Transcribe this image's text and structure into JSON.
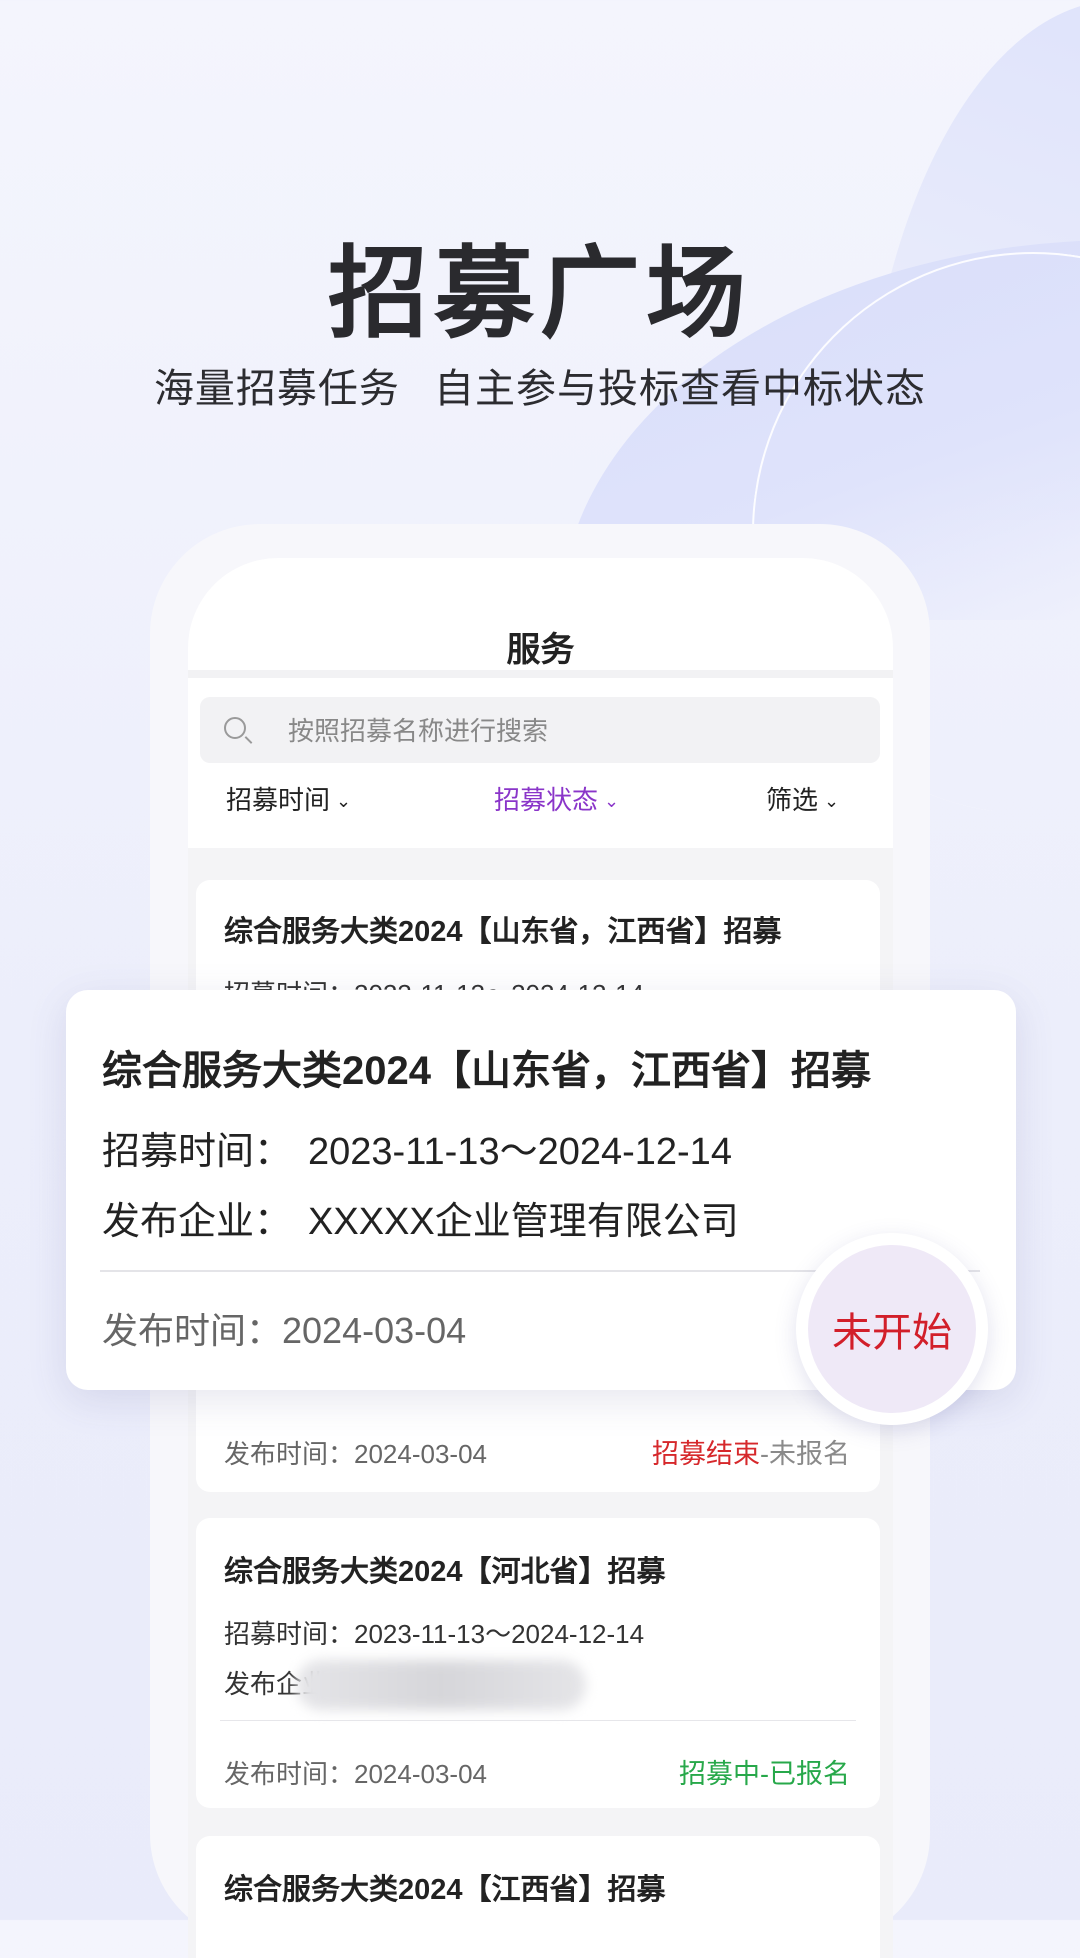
{
  "hero": {
    "title": "招募广场",
    "subtitle": "海量招募任务 自主参与投标查看中标状态"
  },
  "screen": {
    "nav_title": "服务",
    "search": {
      "placeholder": "按照招募名称进行搜索"
    },
    "filters": [
      {
        "label": "招募时间",
        "active": false
      },
      {
        "label": "招募状态",
        "active": true
      },
      {
        "label": "筛选",
        "active": false
      }
    ],
    "cards": [
      {
        "title": "综合服务大类2024【山东省，江西省】招募",
        "recruit_time_label": "招募时间：",
        "recruit_time": "2023-11-13～2024-12-14",
        "publish_label": "发布时间：",
        "publish_date": "2024-03-04",
        "status_main": "招募结束",
        "status_sub": "-未报名"
      },
      {
        "title": "综合服务大类2024【河北省】招募",
        "recruit_time_label": "招募时间：",
        "recruit_time": "2023-11-13～2024-12-14",
        "company_label": "发布企业：",
        "publish_label": "发布时间：",
        "publish_date": "2024-03-04",
        "status_main": "招募中-已报名"
      },
      {
        "title": "综合服务大类2024【江西省】招募"
      }
    ]
  },
  "overlay": {
    "title": "综合服务大类2024【山东省，江西省】招募",
    "recruit_time_label": "招募时间：",
    "recruit_time": "2023-11-13～2024-12-14",
    "company_label": "发布企业：",
    "company": "XXXXX企业管理有限公司",
    "publish_label": "发布时间：",
    "publish_date": "2024-03-04",
    "badge": "未开始"
  },
  "colors": {
    "accent_purple": "#8a35c9",
    "status_red": "#d6282b",
    "status_green": "#27a84a"
  }
}
